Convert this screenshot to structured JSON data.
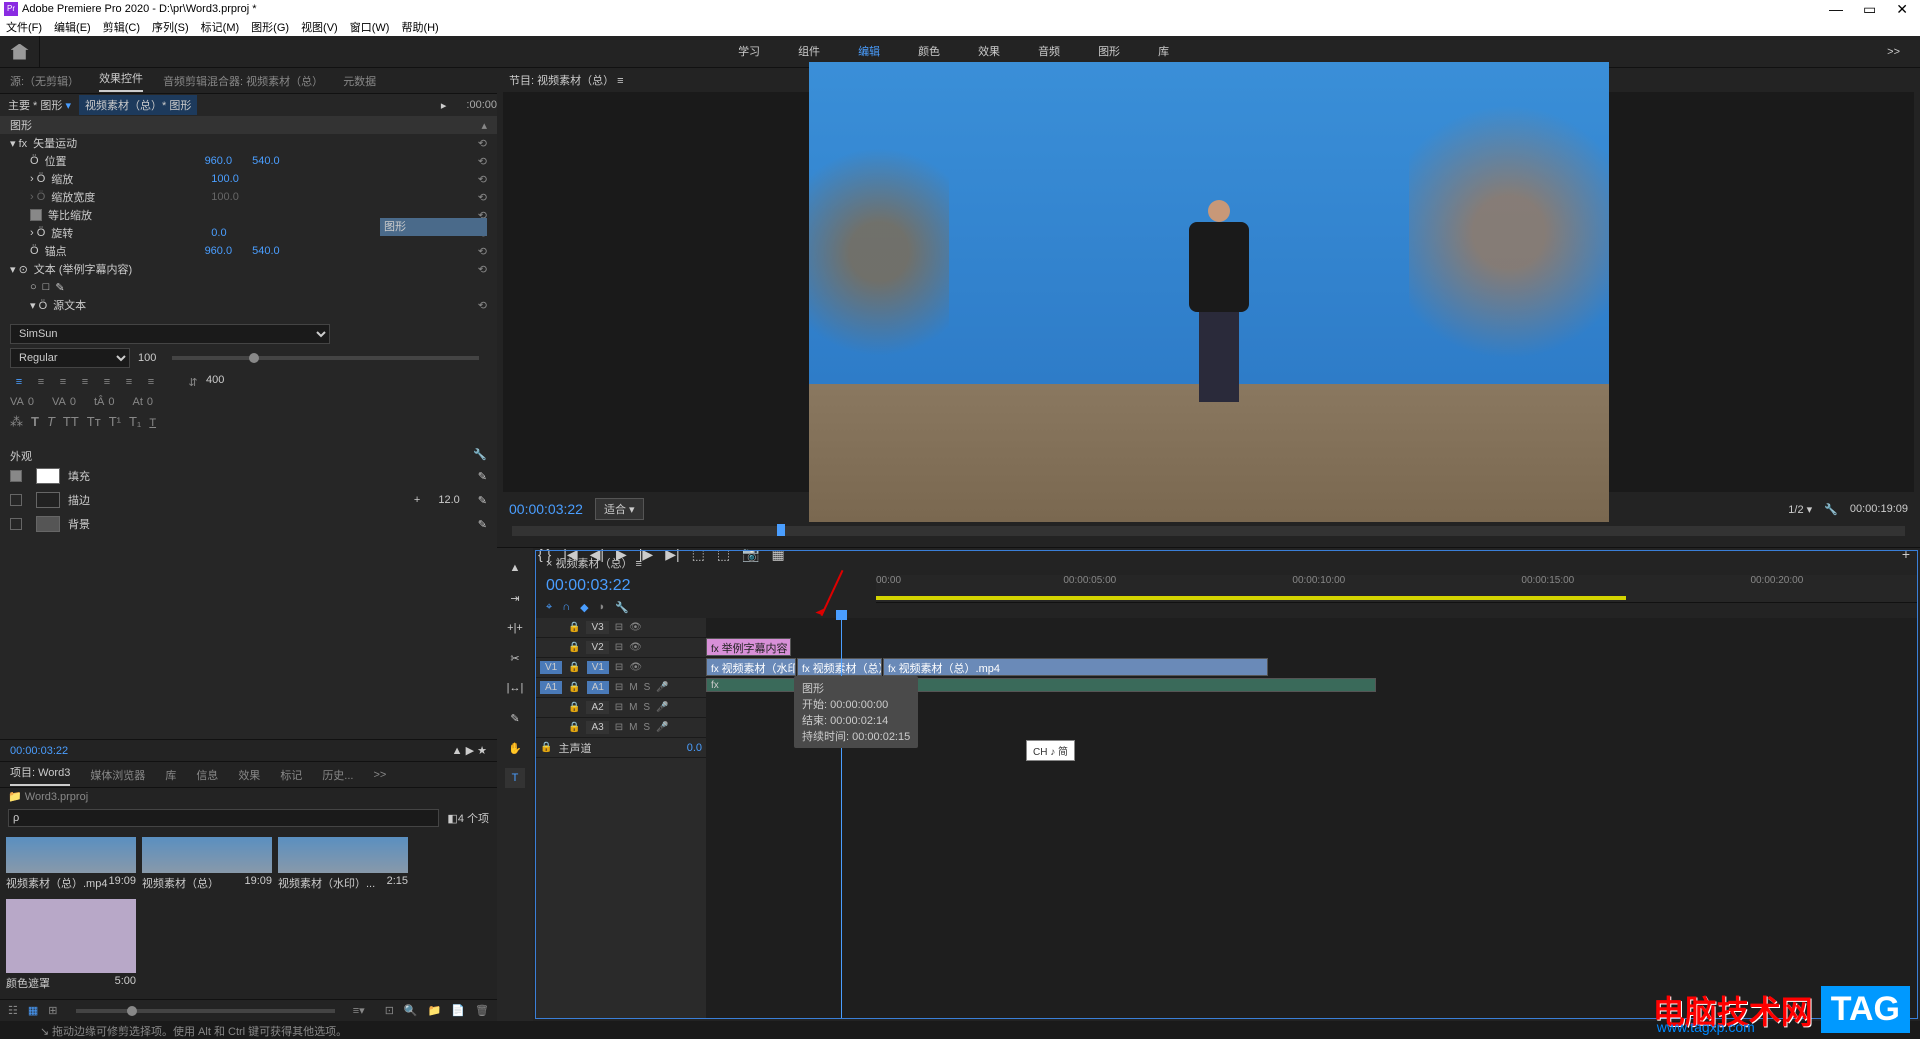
{
  "titlebar": {
    "app_icon_text": "Pr",
    "title": "Adobe Premiere Pro 2020 - D:\\pr\\Word3.prproj *"
  },
  "menubar": {
    "items": [
      "文件(F)",
      "编辑(E)",
      "剪辑(C)",
      "序列(S)",
      "标记(M)",
      "图形(G)",
      "视图(V)",
      "窗口(W)",
      "帮助(H)"
    ]
  },
  "workspace": {
    "tabs": [
      "学习",
      "组件",
      "编辑",
      "颜色",
      "效果",
      "音频",
      "图形",
      "库"
    ],
    "active": "编辑",
    "more": ">>"
  },
  "source_tabs": {
    "items": [
      "源:（无剪辑）",
      "效果控件",
      "音频剪辑混合器: 视频素材（总）",
      "元数据"
    ],
    "active": "效果控件"
  },
  "effect_controls": {
    "clip_label": "主要 * 图形",
    "seq_link": "视频素材（总）* 图形",
    "time_header": ":00:00",
    "section_graphic": "图形",
    "timeline_track_label": "图形",
    "vector_motion": "矢量运动",
    "position_label": "位置",
    "position_x": "960.0",
    "position_y": "540.0",
    "scale_label": "缩放",
    "scale_val": "100.0",
    "scale_width_label": "缩放宽度",
    "scale_width_val": "100.0",
    "uniform_label": "等比缩放",
    "rotation_label": "旋转",
    "rotation_val": "0.0",
    "anchor_label": "锚点",
    "anchor_x": "960.0",
    "anchor_y": "540.0",
    "text_label": "文本 (举例字幕内容)",
    "source_text": "源文本",
    "font_family": "SimSun",
    "font_style": "Regular",
    "font_size": "100",
    "tracking_value": "400",
    "spacing_va": "0",
    "spacing_va2": "0",
    "spacing_ta": "0",
    "spacing_at": "0",
    "appearance_label": "外观",
    "fill_label": "填充",
    "stroke_label": "描边",
    "stroke_val": "12.0",
    "background_label": "背景",
    "bottom_tc": "00:00:03:22"
  },
  "project_tabs": {
    "items": [
      "项目: Word3",
      "媒体浏览器",
      "库",
      "信息",
      "效果",
      "标记",
      "历史..."
    ],
    "active": "项目: Word3",
    "more": ">>"
  },
  "project": {
    "breadcrumb": "Word3.prproj",
    "search_placeholder": "",
    "count": "4 个项",
    "items": [
      {
        "name": "视频素材（总）.mp4",
        "duration": "19:09"
      },
      {
        "name": "视频素材（总）",
        "duration": "19:09"
      },
      {
        "name": "视频素材（水印）...",
        "duration": "2:15"
      },
      {
        "name": "颜色遮罩",
        "duration": "5:00"
      }
    ]
  },
  "program": {
    "title": "节目: 视频素材（总） ≡",
    "timecode": "00:00:03:22",
    "fit": "适合",
    "fraction": "1/2",
    "duration": "00:00:19:09"
  },
  "timeline": {
    "title": "× 视频素材（总） ≡",
    "timecode": "00:00:03:22",
    "ruler_ticks": [
      "00:00",
      "00:00:05:00",
      "00:00:10:00",
      "00:00:15:00",
      "00:00:20:00"
    ],
    "tracks_video": [
      "V3",
      "V2",
      "V1"
    ],
    "tracks_audio": [
      "A1",
      "A2",
      "A3"
    ],
    "source_v1": "V1",
    "source_a1": "A1",
    "master": "主声道",
    "master_val": "0.0",
    "clips": {
      "graphic": "举例字幕内容",
      "video1": "视频素材（水印）",
      "video2": "视频素材（总）",
      "video3": "视频素材（总）.mp4"
    },
    "tooltip": {
      "title": "图形",
      "start": "开始: 00:00:00:00",
      "end": "结束: 00:00:02:14",
      "duration": "持续时间: 00:00:02:15"
    },
    "badge": "CH ♪ 简"
  },
  "statusbar": {
    "text": "拖动边缘可修剪选择项。使用 Alt 和 Ctrl 键可获得其他选项。"
  },
  "watermark": {
    "cn": "电脑技术网",
    "url": "www.tagxp.com",
    "tag": "TAG"
  }
}
